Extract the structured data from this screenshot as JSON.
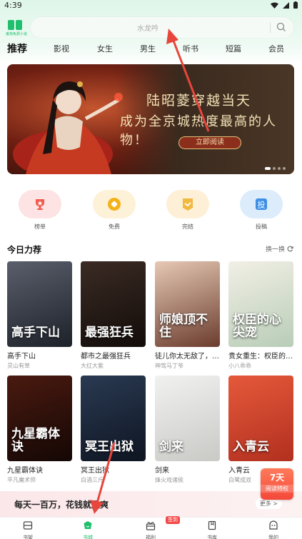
{
  "status_bar": {
    "time": "4:39"
  },
  "logo": {
    "text": "番茄免费小说"
  },
  "search": {
    "placeholder": "水龙吟"
  },
  "tabs": [
    {
      "label": "推荐",
      "active": true
    },
    {
      "label": "影视"
    },
    {
      "label": "女生"
    },
    {
      "label": "男生"
    },
    {
      "label": "听书"
    },
    {
      "label": "短篇"
    },
    {
      "label": "会员"
    }
  ],
  "banner": {
    "line1": "陆昭菱穿越当天",
    "line2": "成为全京城热度最高的人物！",
    "button": "立即阅读"
  },
  "quick_links": [
    {
      "label": "榜单",
      "icon": "trophy-icon",
      "bg": "#fde3e3",
      "color": "#f25a4f"
    },
    {
      "label": "免费",
      "icon": "coin-icon",
      "bg": "#fdf1d8",
      "color": "#f4b21a"
    },
    {
      "label": "完结",
      "icon": "check-badge-icon",
      "bg": "#fdf0d6",
      "color": "#f1b940"
    },
    {
      "label": "投稿",
      "icon": "submit-icon",
      "bg": "#dcecfb",
      "color": "#3d8fe6"
    }
  ],
  "section": {
    "title": "今日力荐",
    "refresh": "换一换"
  },
  "books": [
    {
      "title": "高手下山",
      "author": "灵山有草",
      "cover_text": "高手下山",
      "c1": "#5b5f6c",
      "c2": "#1d2129"
    },
    {
      "title": "都市之最强狂兵",
      "author": "大红大紫",
      "cover_text": "最强狂兵",
      "c1": "#3b2b24",
      "c2": "#120c09"
    },
    {
      "title": "徒儿你太无敌了，求...",
      "author": "神驾马丁爷",
      "cover_text": "师娘顶不住",
      "c1": "#e6c9b5",
      "c2": "#6b3c2e"
    },
    {
      "title": "贵女重生：权臣的心...",
      "author": "小八乖乖",
      "cover_text": "权臣的心尖宠",
      "c1": "#f2efe6",
      "c2": "#b8cdb7"
    },
    {
      "title": "九星霸体诀",
      "author": "平凡魔术师",
      "cover_text": "九星霸体诀",
      "c1": "#4a1a10",
      "c2": "#140705"
    },
    {
      "title": "冥王出狱",
      "author": "白酒三斤",
      "cover_text": "冥王出狱",
      "c1": "#2a3a52",
      "c2": "#0e1522"
    },
    {
      "title": "剑来",
      "author": "烽火戏诸侯",
      "cover_text": "剑来",
      "c1": "#f1f1f0",
      "c2": "#c9c9c6"
    },
    {
      "title": "入青云",
      "author": "白鹭成双",
      "cover_text": "入青云",
      "c1": "#e5593b",
      "c2": "#b2301f"
    }
  ],
  "promo": {
    "text": "每天一百万，花钱就是爽",
    "more": "更多 >"
  },
  "float_badge": {
    "big": "7天",
    "small": "阅读特权"
  },
  "bottom_nav": [
    {
      "label": "书架",
      "icon": "bookshelf-icon"
    },
    {
      "label": "书城",
      "icon": "bookstore-icon",
      "active": true
    },
    {
      "label": "福利",
      "icon": "gift-icon"
    },
    {
      "label": "书库",
      "icon": "library-icon"
    },
    {
      "label": "我的",
      "icon": "profile-icon"
    }
  ],
  "nav_badge": "签到",
  "colors": {
    "accent": "#1fbf6e",
    "arrow": "#e8453c"
  }
}
